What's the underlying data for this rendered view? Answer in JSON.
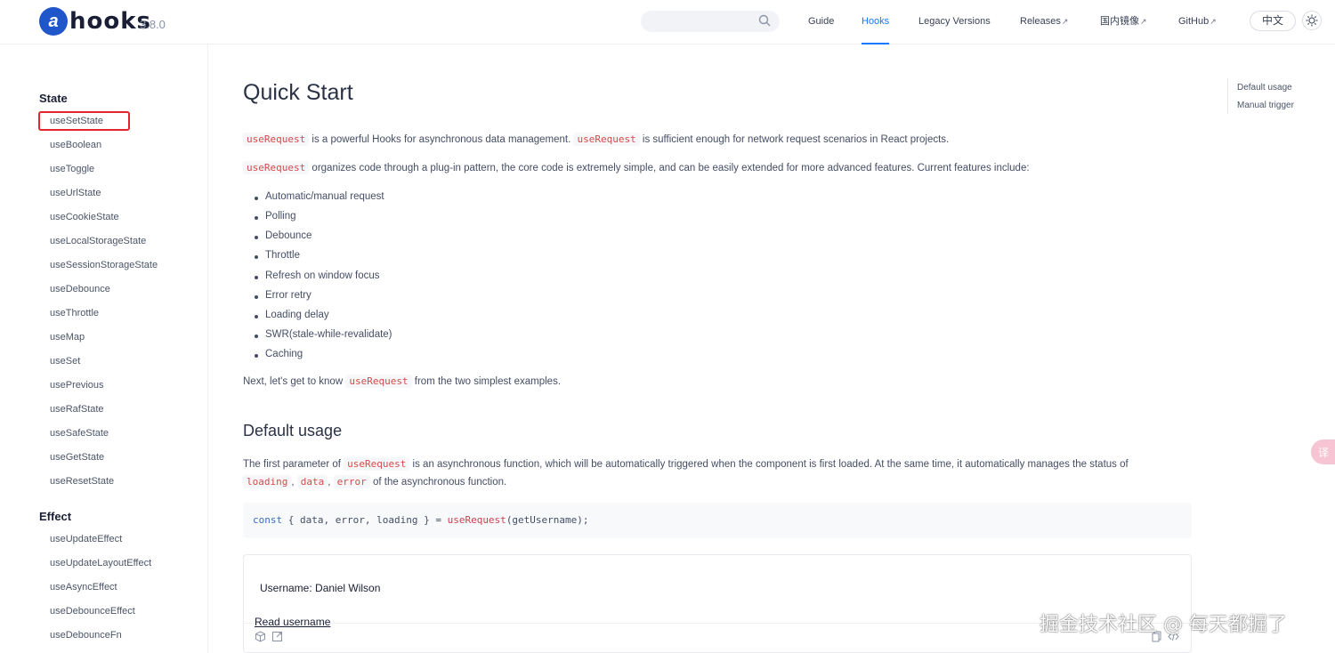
{
  "header": {
    "logo_letter": "a",
    "brand": "hooks",
    "version": "3.8.0",
    "nav": [
      {
        "label": "Guide",
        "external": false
      },
      {
        "label": "Hooks",
        "external": false,
        "active": true
      },
      {
        "label": "Legacy Versions",
        "external": false
      },
      {
        "label": "Releases",
        "external": true
      },
      {
        "label": "国内镜像",
        "external": true
      },
      {
        "label": "GitHub",
        "external": true
      }
    ],
    "language": "中文",
    "accent_color": "#1677ff"
  },
  "sidebar": {
    "groups": [
      {
        "title": "State",
        "items": [
          "useSetState",
          "useBoolean",
          "useToggle",
          "useUrlState",
          "useCookieState",
          "useLocalStorageState",
          "useSessionStorageState",
          "useDebounce",
          "useThrottle",
          "useMap",
          "useSet",
          "usePrevious",
          "useRafState",
          "useSafeState",
          "useGetState",
          "useResetState"
        ]
      },
      {
        "title": "Effect",
        "items": [
          "useUpdateEffect",
          "useUpdateLayoutEffect",
          "useAsyncEffect",
          "useDebounceEffect",
          "useDebounceFn"
        ]
      }
    ],
    "highlighted_item": "useSetState"
  },
  "main": {
    "title": "Quick Start",
    "code_term": "useRequest",
    "p1_mid": " is a powerful Hooks for asynchronous data management. ",
    "p1_end": " is sufficient enough for network request scenarios in React projects.",
    "p2_end": " organizes code through a plug-in pattern, the core code is extremely simple, and can be easily extended for more advanced features. Current features include:",
    "features": [
      "Automatic/manual request",
      "Polling",
      "Debounce",
      "Throttle",
      "Refresh on window focus",
      "Error retry",
      "Loading delay",
      "SWR(stale-while-revalidate)",
      "Caching"
    ],
    "next_start": "Next, let's get to know ",
    "next_end": " from the two simplest examples.",
    "section_title": "Default usage",
    "usage_start": "The first parameter of ",
    "usage_mid": " is an asynchronous function, which will be automatically triggered when the component is first loaded. At the same time, it automatically manages the status of",
    "usage_codes": [
      "loading",
      "data",
      "error"
    ],
    "usage_end": " of the asynchronous function.",
    "code": {
      "kw": "const",
      "vars": "{ data, error, loading }",
      "eq": " = ",
      "fn": "useRequest",
      "args": "(getUsername);"
    },
    "demo": {
      "text": "Username: Daniel Wilson",
      "link": "Read username"
    }
  },
  "toc": {
    "items": [
      "Default usage",
      "Manual trigger"
    ]
  },
  "float_button": "译",
  "watermark": "掘金技术社区 @ 每天都掘了"
}
